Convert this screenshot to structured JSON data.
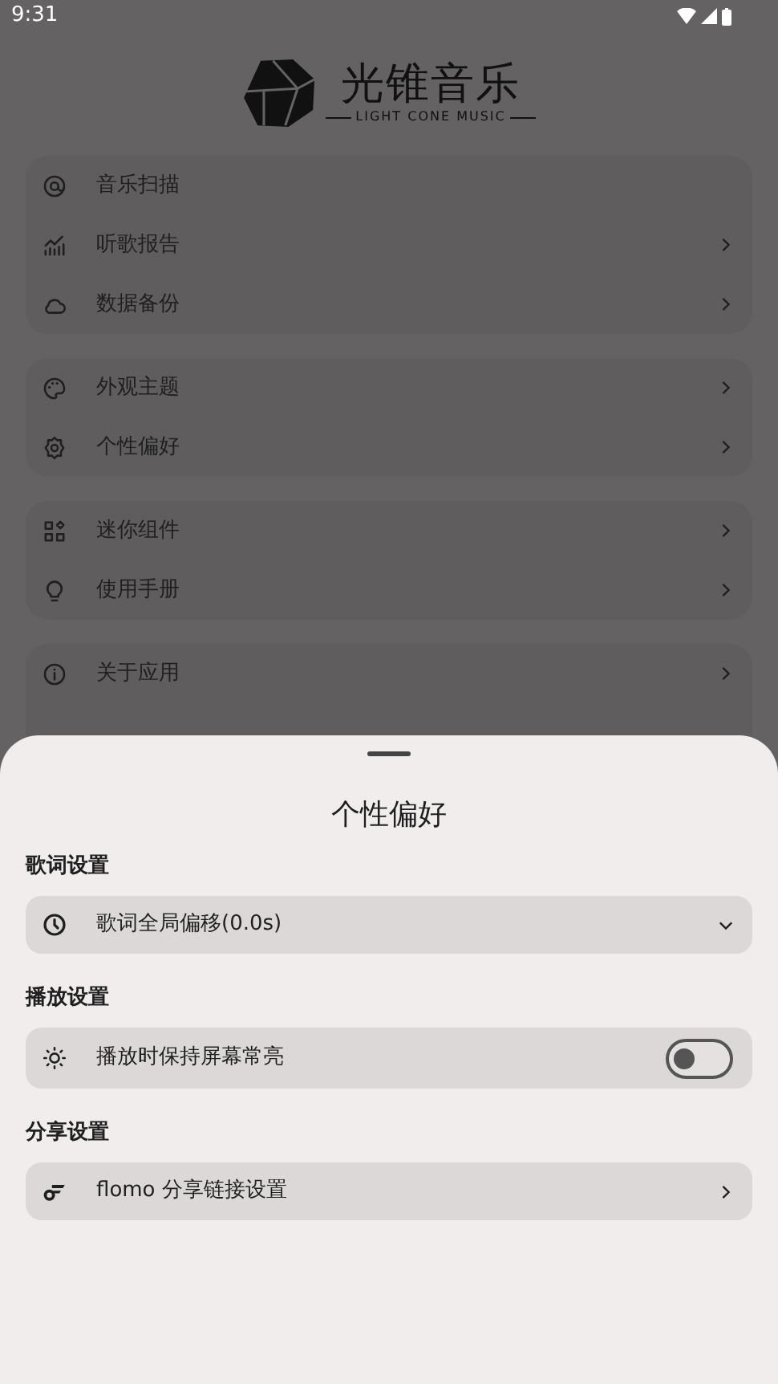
{
  "status_bar": {
    "time": "9:31"
  },
  "logo": {
    "title": "光锥音乐",
    "subtitle": "LIGHT CONE MUSIC"
  },
  "menu_groups": [
    {
      "items": [
        {
          "label": "音乐扫描",
          "chevron": false
        },
        {
          "label": "听歌报告",
          "chevron": true
        },
        {
          "label": "数据备份",
          "chevron": true
        }
      ]
    },
    {
      "items": [
        {
          "label": "外观主题",
          "chevron": true
        },
        {
          "label": "个性偏好",
          "chevron": true
        }
      ]
    },
    {
      "items": [
        {
          "label": "迷你组件",
          "chevron": true
        },
        {
          "label": "使用手册",
          "chevron": true
        }
      ]
    },
    {
      "items": [
        {
          "label": "关于应用",
          "chevron": true
        }
      ]
    }
  ],
  "sheet": {
    "title": "个性偏好",
    "sections": [
      {
        "header": "歌词设置",
        "item": {
          "kind": "dropdown",
          "label": "歌词全局偏移(0.0s)"
        }
      },
      {
        "header": "播放设置",
        "item": {
          "kind": "switch",
          "label": "播放时保持屏幕常亮",
          "on": false
        }
      },
      {
        "header": "分享设置",
        "item": {
          "kind": "link",
          "label": "flomo 分享链接设置"
        }
      }
    ]
  }
}
